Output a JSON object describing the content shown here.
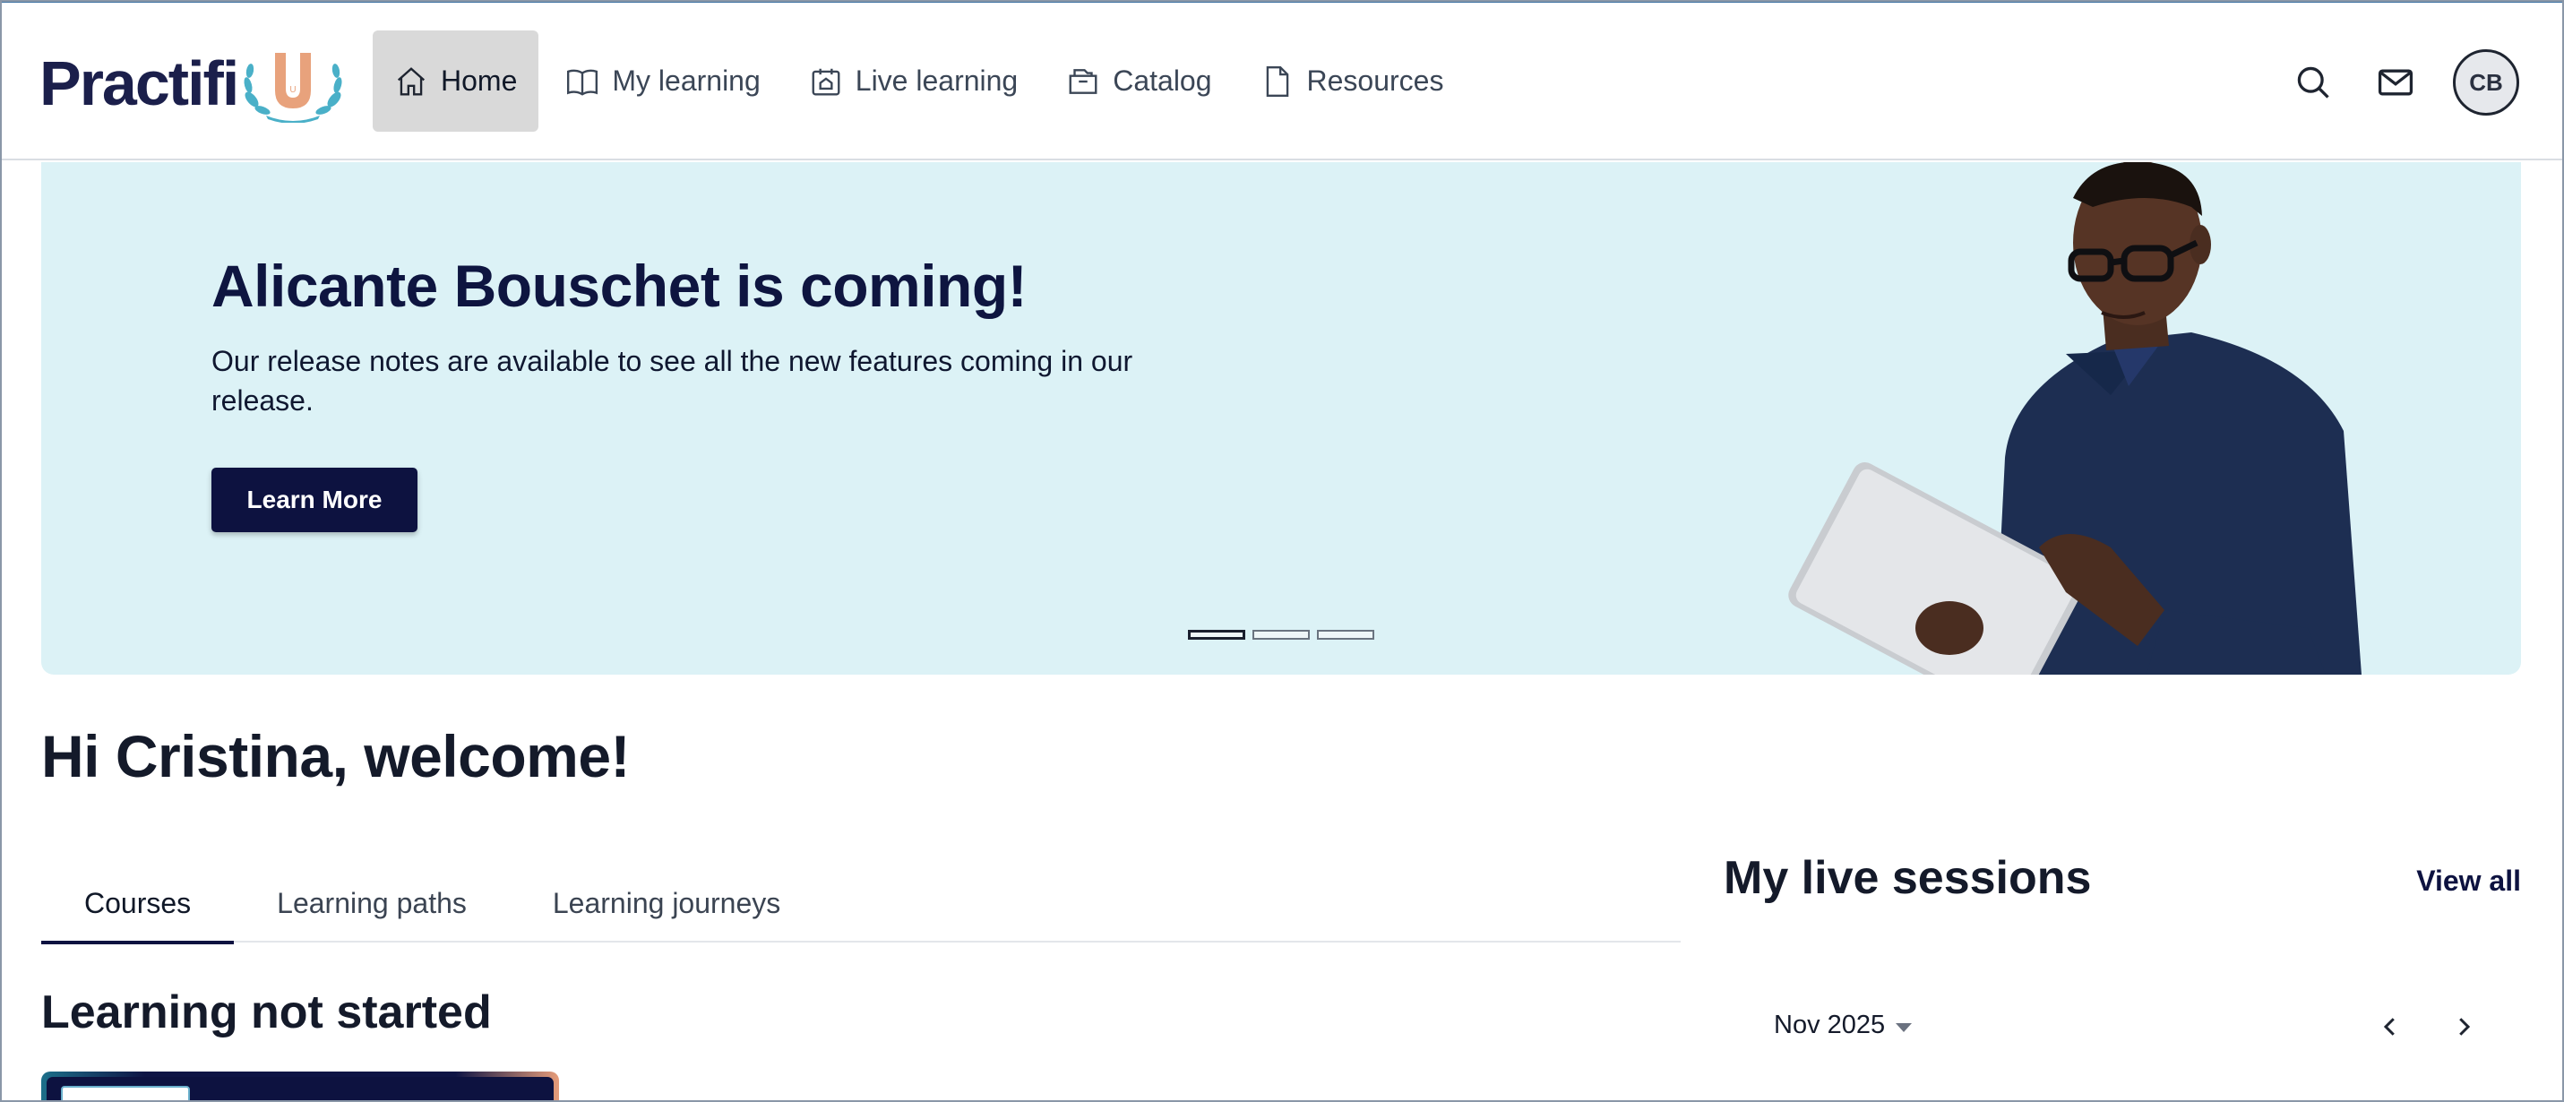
{
  "brand": {
    "logo_text": "Practifi",
    "logo_letter": "U"
  },
  "nav": {
    "items": [
      {
        "label": "Home",
        "icon": "home-icon",
        "active": true
      },
      {
        "label": "My learning",
        "icon": "book-icon",
        "active": false
      },
      {
        "label": "Live learning",
        "icon": "calendar-icon",
        "active": false
      },
      {
        "label": "Catalog",
        "icon": "folder-icon",
        "active": false
      },
      {
        "label": "Resources",
        "icon": "document-icon",
        "active": false
      }
    ]
  },
  "header": {
    "search_icon": "search-icon",
    "mail_icon": "mail-icon",
    "avatar_initials": "CB"
  },
  "hero": {
    "title": "Alicante Bouschet is coming!",
    "description": "Our release notes are available to see all the new features coming in our release.",
    "button_label": "Learn More",
    "slide_count": 3,
    "active_slide": 1
  },
  "welcome": {
    "text": "Hi Cristina, welcome!"
  },
  "tabs": [
    {
      "label": "Courses",
      "active": true
    },
    {
      "label": "Learning paths",
      "active": false
    },
    {
      "label": "Learning journeys",
      "active": false
    }
  ],
  "learning": {
    "section_title": "Learning not started"
  },
  "live_sessions": {
    "title": "My live sessions",
    "view_all_label": "View all",
    "month_label": "Nov 2025"
  },
  "colors": {
    "primary": "#0d1240",
    "hero_bg": "#dcf2f6",
    "nav_active_bg": "#d9d9d9",
    "logo_accent": "#e8a27c",
    "logo_leaf": "#4ab0c8"
  }
}
